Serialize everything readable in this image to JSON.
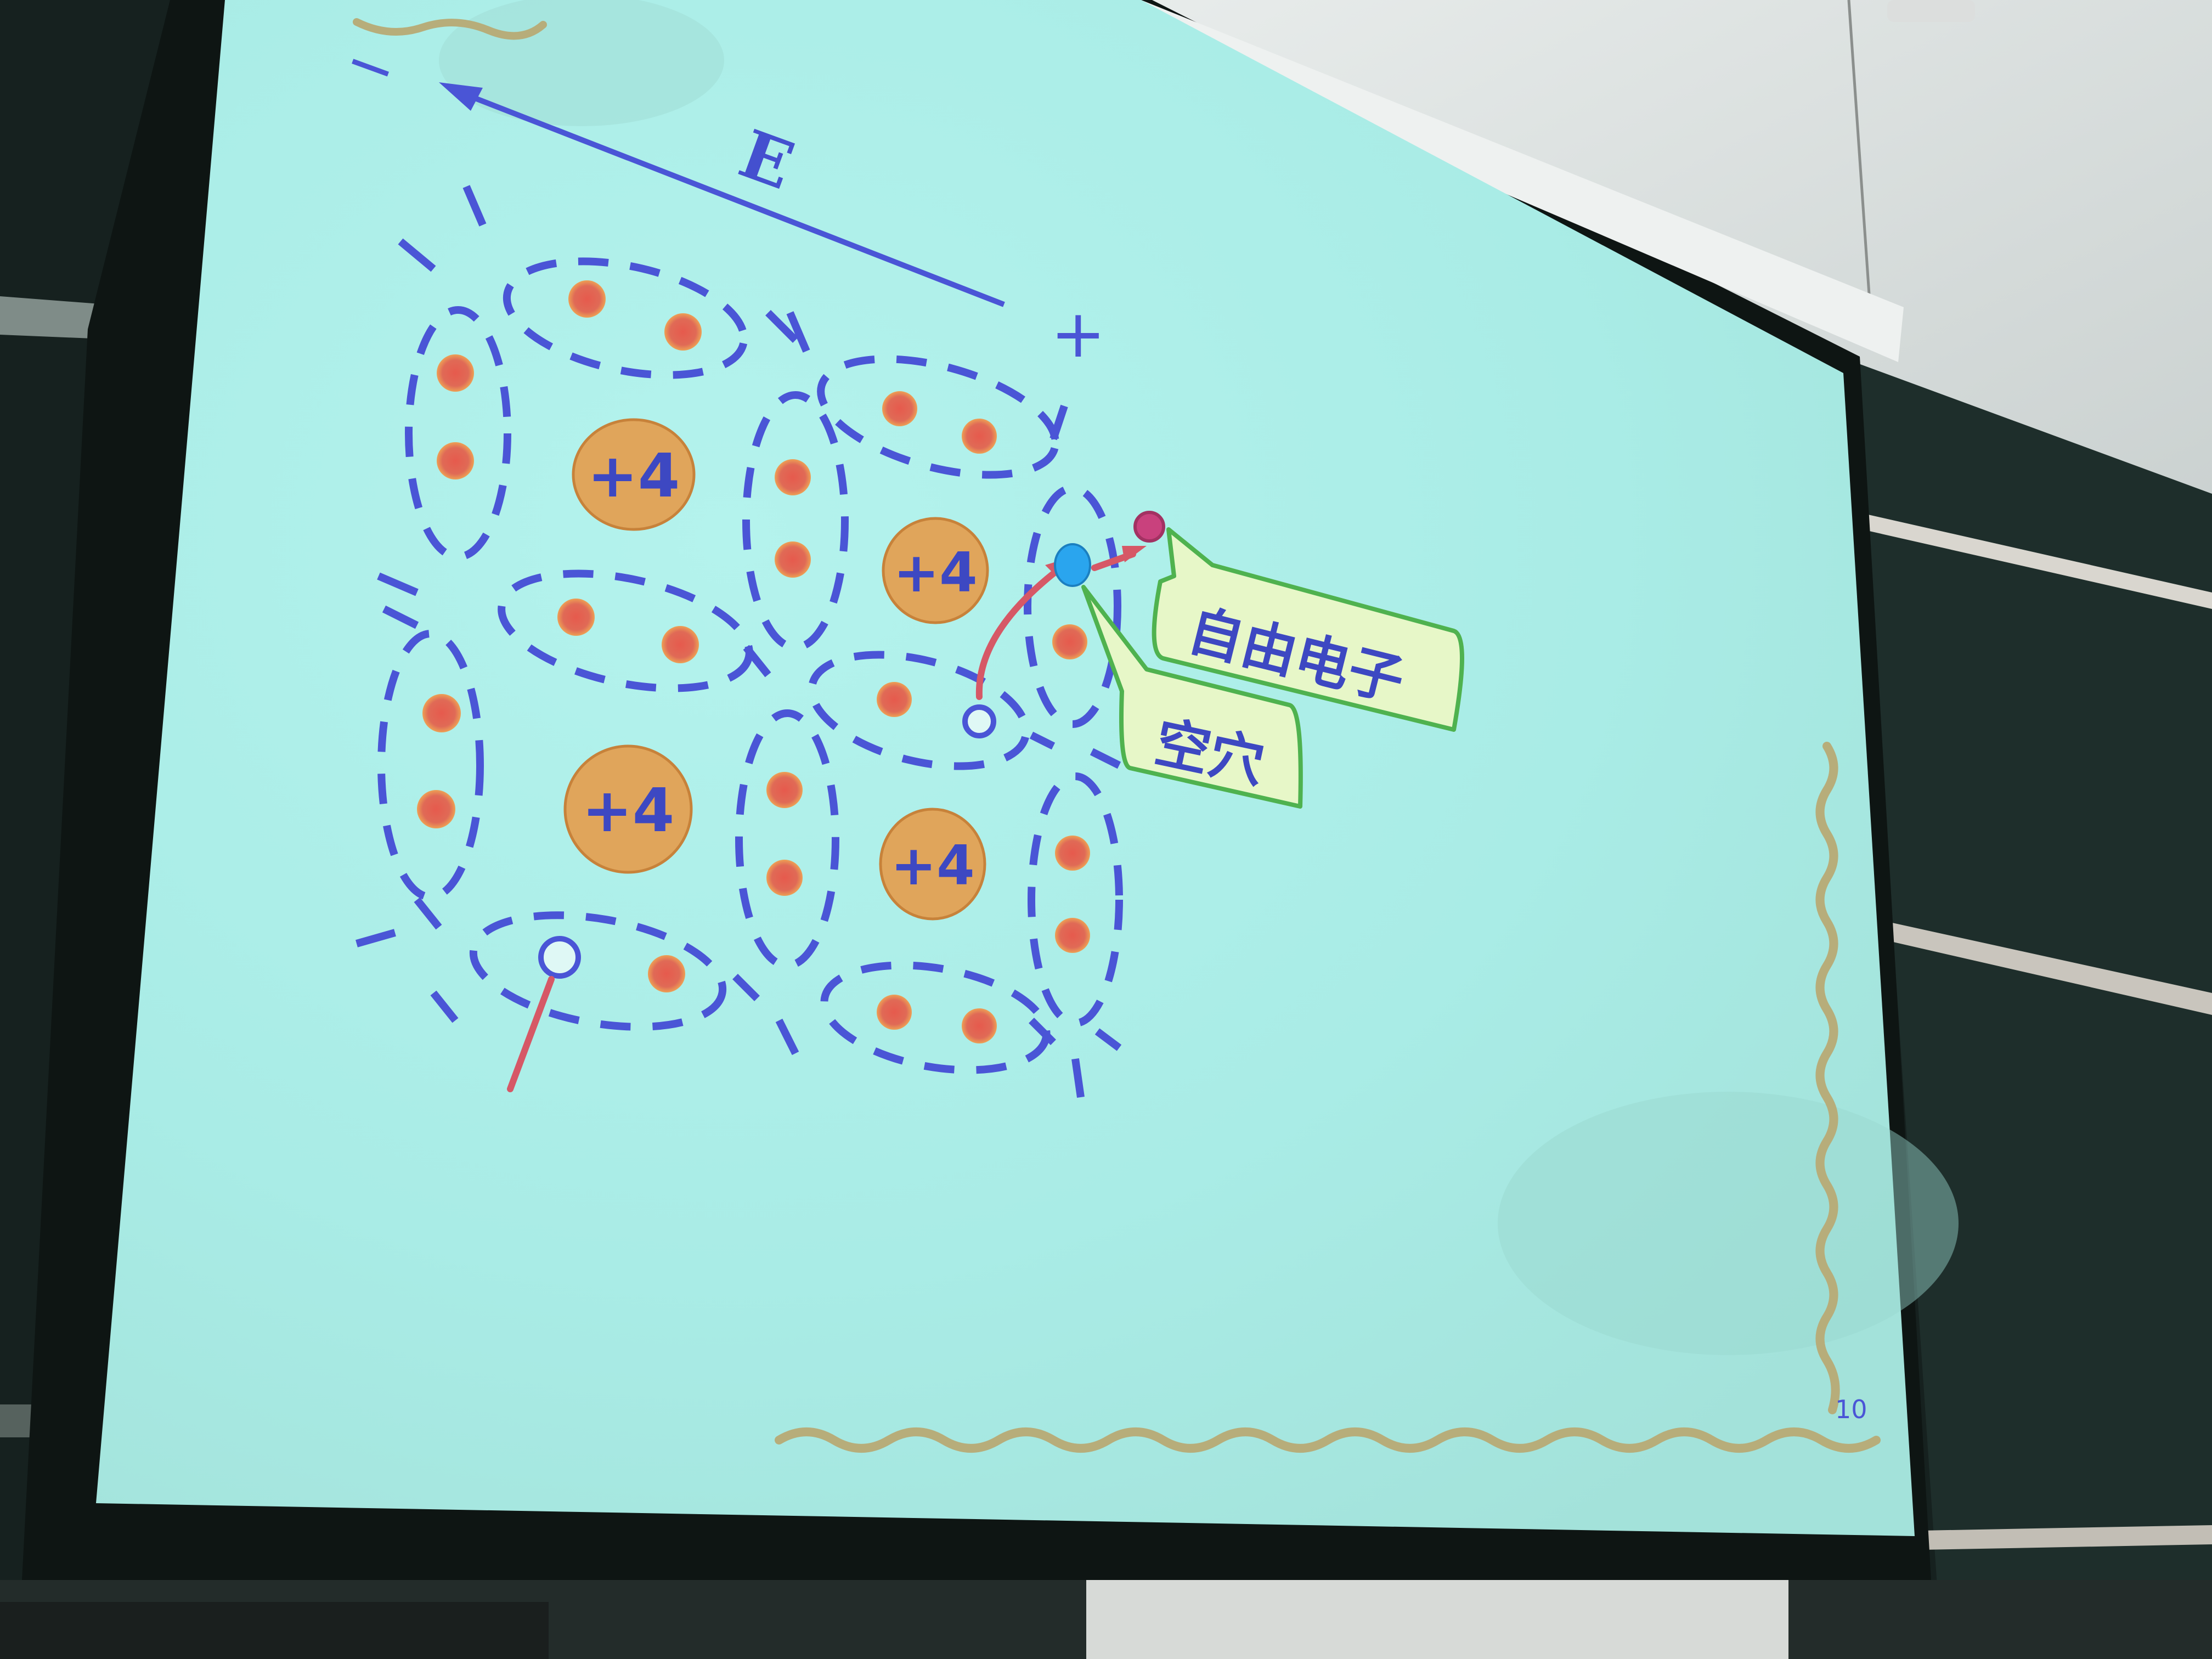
{
  "slide": {
    "field_label": "E",
    "minus_sign": "−",
    "plus_sign": "+",
    "nucleus_charge": "+4",
    "callout_free_electron": "自由电子",
    "callout_hole": "空穴",
    "page_number": "10"
  },
  "colors": {
    "slide_background": "#a9ece6",
    "bond_dash": "#4a55d6",
    "electron": "#e06a56",
    "electron_ring": "#e8a25a",
    "nucleus": "#e0a55b",
    "nucleus_text": "#3d48c2",
    "free_electron": "#2aa5ee",
    "callout_fill": "#e7f7c8",
    "callout_border": "#4fb24f",
    "arrow": "#d65866",
    "border_vine": "#b7ad7a"
  },
  "icons": [
    "electric-field-arrow-icon",
    "hole-circle-icon",
    "free-electron-icon",
    "motion-arrow-icon"
  ]
}
